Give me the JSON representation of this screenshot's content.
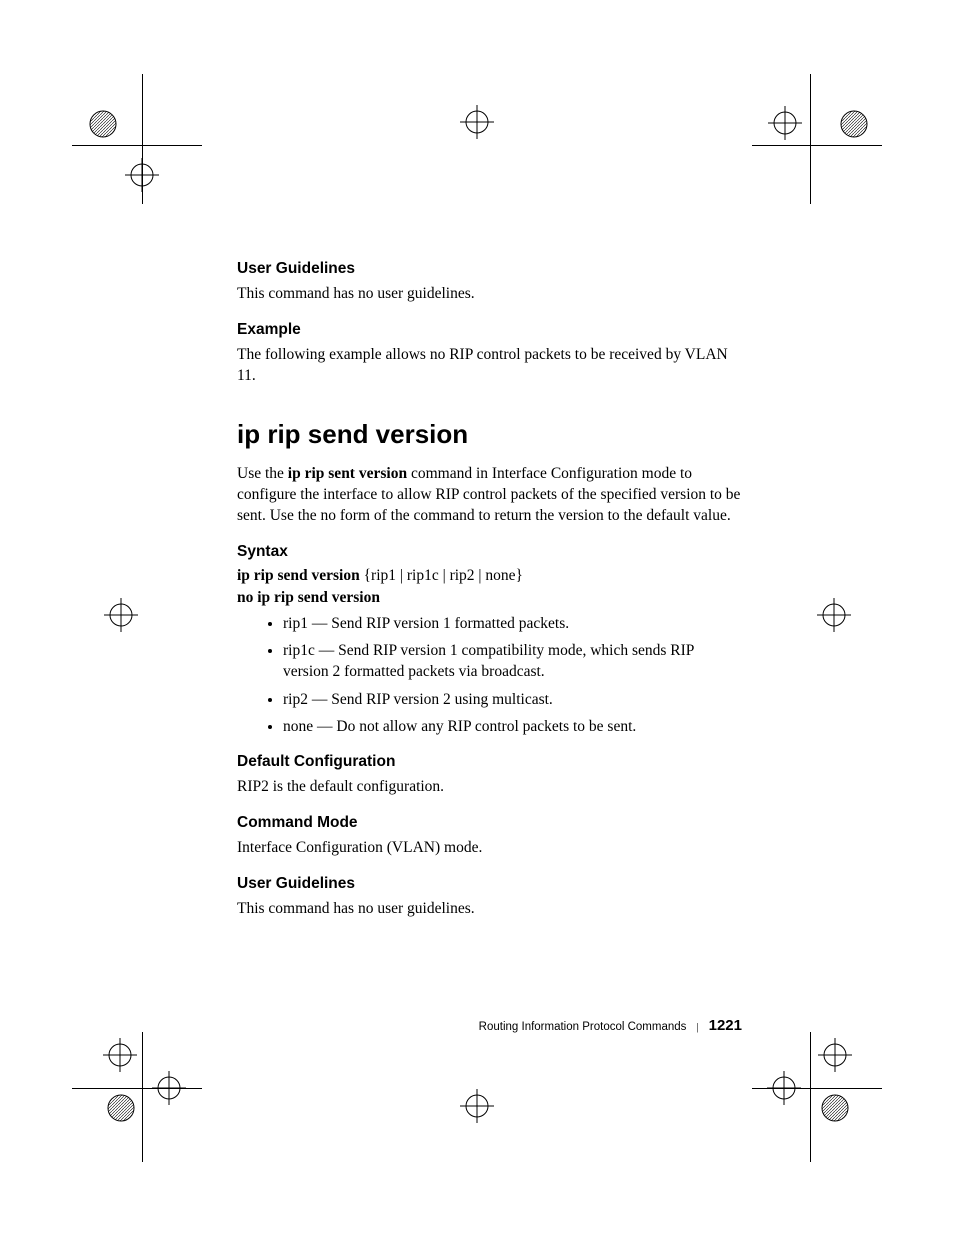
{
  "section1": {
    "heading_user_guidelines": "User Guidelines",
    "ug_body": "This command has no user guidelines.",
    "heading_example": "Example",
    "example_body": "The following example allows no RIP control packets to be received by VLAN 11."
  },
  "title": "ip rip send version",
  "intro": {
    "pre": "Use the ",
    "bold": "ip rip sent version",
    "post": " command in Interface Configuration mode to configure the interface to allow RIP control packets of the specified version to be sent. Use the no form of the command to return the version to the default value."
  },
  "syntax": {
    "heading": "Syntax",
    "line1_bold": "ip rip send version",
    "line1_rest": " {rip1 | rip1c | rip2 | none}",
    "line2_bold": "no ip rip send version",
    "bullets": [
      "rip1 — Send RIP version 1 formatted packets.",
      "rip1c — Send RIP version 1 compatibility mode, which sends RIP version 2 formatted packets via broadcast.",
      "rip2 — Send RIP version 2 using multicast.",
      "none — Do not allow any RIP control packets to be sent."
    ]
  },
  "default_config": {
    "heading": "Default Configuration",
    "body": "RIP2 is the default configuration."
  },
  "command_mode": {
    "heading": "Command Mode",
    "body": "Interface Configuration (VLAN) mode."
  },
  "user_guidelines2": {
    "heading": "User Guidelines",
    "body": "This command has no user guidelines."
  },
  "footer": {
    "section_label": "Routing Information Protocol Commands",
    "page_number": "1221"
  }
}
